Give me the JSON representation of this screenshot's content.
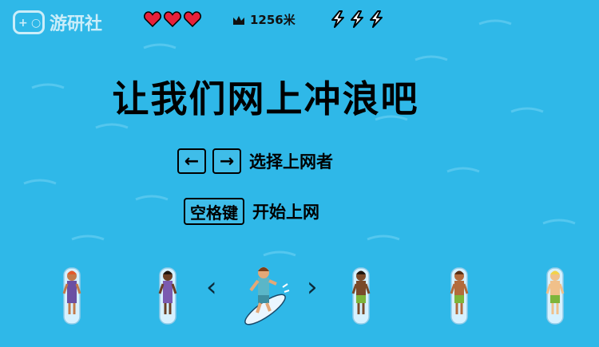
{
  "watermark": {
    "text": "游研社"
  },
  "hud": {
    "lives": 3,
    "distance_text": "1256米",
    "boosts": 3,
    "icons": {
      "heart": "heart-icon",
      "crown": "crown-icon",
      "bolt": "lightning-icon"
    }
  },
  "title": "让我们网上冲浪吧",
  "controls": {
    "left_key": "←",
    "right_key": "→",
    "select_label": "选择上网者",
    "space_key": "空格键",
    "start_label": "开始上网"
  },
  "carousel": {
    "prev_arrow": "‹",
    "next_arrow": "›",
    "selected_index": 2,
    "characters": [
      {
        "skin": "#c47a4a",
        "hair": "#e2592a",
        "top": "#6b4fa3",
        "bottom": "#6b4fa3"
      },
      {
        "skin": "#6b3f25",
        "hair": "#1f140d",
        "top": "#7b5bb0",
        "bottom": "#7b5bb0"
      },
      {
        "skin": "#e3a877",
        "hair": "#7a3f1a",
        "top": "#5ab6c8",
        "bottom": "#3d8ea0"
      },
      {
        "skin": "#7a4a2a",
        "hair": "#1f140d",
        "top": "#7a4a2a",
        "bottom": "#7db53a"
      },
      {
        "skin": "#b36b3c",
        "hair": "#5a2e12",
        "top": "#b36b3c",
        "bottom": "#7db53a"
      },
      {
        "skin": "#f0c08a",
        "hair": "#f2d24a",
        "top": "#f0c08a",
        "bottom": "#7db53a"
      }
    ]
  },
  "colors": {
    "water": "#2fb8e8",
    "heart": "#e8203a",
    "text": "#000000"
  }
}
